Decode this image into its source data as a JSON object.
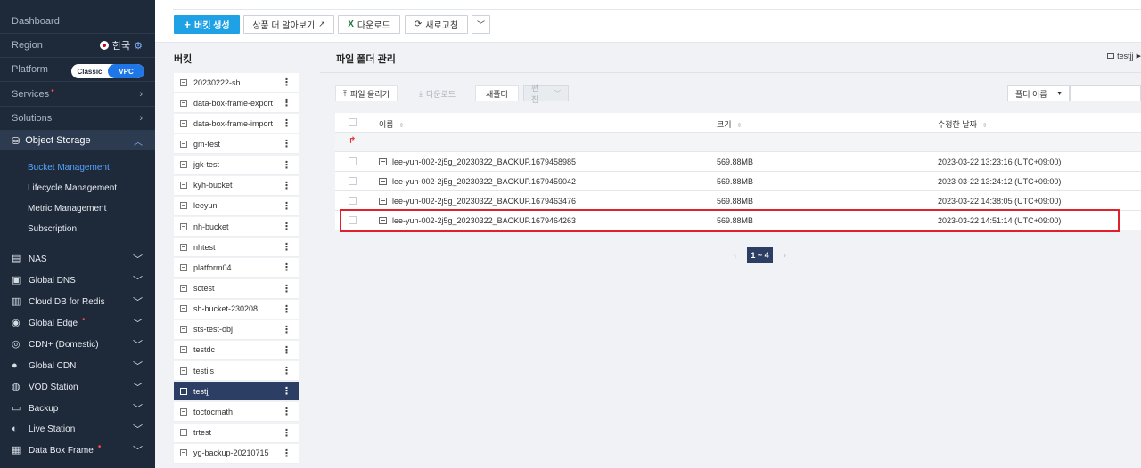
{
  "sidebar": {
    "dashboard": "Dashboard",
    "region_label": "Region",
    "region_value": "한국",
    "platform_label": "Platform",
    "platform_classic": "Classic",
    "platform_vpc": "VPC",
    "services": "Services",
    "solutions": "Solutions",
    "object_storage": "Object Storage",
    "sub_items": [
      "Bucket Management",
      "Lifecycle Management",
      "Metric Management",
      "Subscription"
    ],
    "services_list": [
      {
        "label": "NAS",
        "badge": false
      },
      {
        "label": "Global DNS",
        "badge": false
      },
      {
        "label": "Cloud DB for Redis",
        "badge": false
      },
      {
        "label": "Global Edge",
        "badge": true
      },
      {
        "label": "CDN+ (Domestic)",
        "badge": false
      },
      {
        "label": "Global CDN",
        "badge": false
      },
      {
        "label": "VOD Station",
        "badge": false
      },
      {
        "label": "Backup",
        "badge": false
      },
      {
        "label": "Live Station",
        "badge": false
      },
      {
        "label": "Data Box Frame",
        "badge": true
      }
    ]
  },
  "toolbar": {
    "create_bucket": "버킷 생성",
    "learn_more": "상품 더 알아보기",
    "download": "다운로드",
    "refresh": "새로고침"
  },
  "bucket_panel": {
    "title": "버킷",
    "buckets": [
      "20230222-sh",
      "data-box-frame-export",
      "data-box-frame-import",
      "gm-test",
      "jgk-test",
      "kyh-bucket",
      "leeyun",
      "nh-bucket",
      "nhtest",
      "platform04",
      "sctest",
      "sh-bucket-230208",
      "sts-test-obj",
      "testdc",
      "testiis",
      "testjj",
      "toctocmath",
      "trtest",
      "yg-backup-20210715"
    ],
    "selected": "testjj"
  },
  "main": {
    "title": "파일 폴더 관리",
    "breadcrumb": "testjj",
    "actions": {
      "upload": "파일 올리기",
      "download": "다운로드",
      "new_folder": "새폴더",
      "edit": "편집"
    },
    "sort_select": "폴더 이름",
    "columns": {
      "name": "이름",
      "size": "크기",
      "modified": "수정한 날짜"
    },
    "rows": [
      {
        "name": "lee-yun-002-2j5g_20230322_BACKUP.1679458985",
        "size": "569.88MB",
        "modified": "2023-03-22 13:23:16 (UTC+09:00)"
      },
      {
        "name": "lee-yun-002-2j5g_20230322_BACKUP.1679459042",
        "size": "569.88MB",
        "modified": "2023-03-22 13:24:12 (UTC+09:00)"
      },
      {
        "name": "lee-yun-002-2j5g_20230322_BACKUP.1679463476",
        "size": "569.88MB",
        "modified": "2023-03-22 14:38:05 (UTC+09:00)"
      },
      {
        "name": "lee-yun-002-2j5g_20230322_BACKUP.1679464263",
        "size": "569.88MB",
        "modified": "2023-03-22 14:51:14 (UTC+09:00)"
      }
    ],
    "pagination": "1 ~ 4"
  },
  "colors": {
    "sidebar_bg": "#1e2a3a",
    "primary": "#1fa1e6",
    "selected_bg": "#2c3e63",
    "highlight": "#e0202a"
  }
}
